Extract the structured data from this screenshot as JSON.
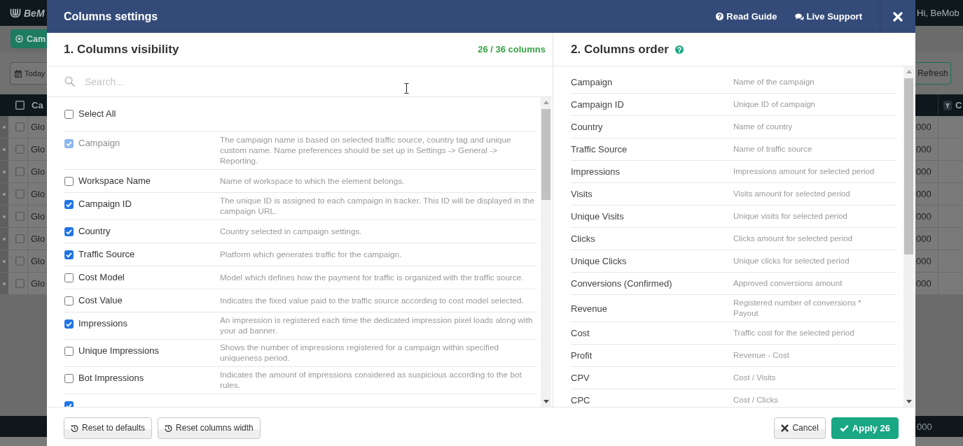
{
  "background": {
    "logo": "BeM",
    "greeting": "Hi, BeMob",
    "campaigns_button": "Cam",
    "date_button": "Today",
    "refresh_button": "Refresh",
    "table": {
      "header": {
        "checked": false,
        "column_1": "Ca",
        "column_2": "C"
      },
      "rows": [
        {
          "checked": false,
          "column_1": "Glo",
          "column_2": "000"
        },
        {
          "checked": false,
          "column_1": "Glo",
          "column_2": "000"
        },
        {
          "checked": false,
          "column_1": "Glo",
          "column_2": "000"
        },
        {
          "checked": false,
          "column_1": "Glo",
          "column_2": "000"
        },
        {
          "checked": false,
          "column_1": "Glo",
          "column_2": "000"
        },
        {
          "checked": false,
          "column_1": "Glo",
          "column_2": "000"
        },
        {
          "checked": false,
          "column_1": "Glo",
          "column_2": "000"
        },
        {
          "checked": false,
          "column_1": "Glo",
          "column_2": "000"
        }
      ],
      "totals": {
        "column_2": "000"
      }
    }
  },
  "dialog": {
    "title": "Columns settings",
    "header_links": [
      {
        "kind": "guide",
        "label": "Read Guide"
      },
      {
        "kind": "support",
        "label": "Live Support"
      }
    ],
    "visibility": {
      "title": "1. Columns visibility",
      "counter": "26 / 36 columns",
      "search": {
        "placeholder": "Search..."
      },
      "select_all": {
        "label": "Select All",
        "checked": false
      },
      "columns": [
        {
          "label": "Campaign",
          "description": "The campaign name is based on selected traffic source, country tag and unique custom name. Name preferences should be set up in Settings -> General -> Reporting.",
          "checked": true,
          "disabled": true
        },
        {
          "label": "Workspace Name",
          "description": "Name of workspace to which the element belongs.",
          "checked": false,
          "disabled": false
        },
        {
          "label": "Campaign ID",
          "description": "The unique ID is assigned to each campaign in tracker. This ID will be displayed in the campaign URL.",
          "checked": true,
          "disabled": false
        },
        {
          "label": "Country",
          "description": "Country selected in campaign settings.",
          "checked": true,
          "disabled": false
        },
        {
          "label": "Traffic Source",
          "description": "Platform which generates traffic for the campaign.",
          "checked": true,
          "disabled": false
        },
        {
          "label": "Cost Model",
          "description": "Model which defines how the payment for traffic is organized with the traffic source.",
          "checked": false,
          "disabled": false
        },
        {
          "label": "Cost Value",
          "description": "Indicates the fixed value paid to the traffic source according to cost model selected.",
          "checked": false,
          "disabled": false
        },
        {
          "label": "Impressions",
          "description": "An impression is registered each time the dedicated impression pixel loads along with your ad banner.",
          "checked": true,
          "disabled": false
        },
        {
          "label": "Unique Impressions",
          "description": "Shows the number of impressions registered for a campaign within specified uniqueness period.",
          "checked": false,
          "disabled": false
        },
        {
          "label": "Bot Impressions",
          "description": "Indicates the amount of impressions considered as suspicious according to the bot rules.",
          "checked": false,
          "disabled": false
        },
        {
          "checked": true,
          "disabled": false
        }
      ]
    },
    "order": {
      "title": "2. Columns order",
      "columns": [
        {
          "label": "Campaign",
          "description": "Name of the campaign"
        },
        {
          "label": "Campaign ID",
          "description": "Unique ID of campaign"
        },
        {
          "label": "Country",
          "description": "Name of country"
        },
        {
          "label": "Traffic Source",
          "description": "Name of traffic source"
        },
        {
          "label": "Impressions",
          "description": "Impressions amount for selected period"
        },
        {
          "label": "Visits",
          "description": "Visits amount for selected period"
        },
        {
          "label": "Unique Visits",
          "description": "Unique visits for selected period"
        },
        {
          "label": "Clicks",
          "description": "Clicks amount for selected period"
        },
        {
          "label": "Unique Clicks",
          "description": "Unique clicks for selected period"
        },
        {
          "label": "Conversions (Confirmed)",
          "description": "Approved conversions amount"
        },
        {
          "label": "Revenue",
          "description": "Registered number of conversions * Payout"
        },
        {
          "label": "Cost",
          "description": "Traffic cost for the selected period"
        },
        {
          "label": "Profit",
          "description": "Revenue - Cost"
        },
        {
          "label": "CPV",
          "description": "Cost / Visits"
        },
        {
          "label": "CPC",
          "description": "Cost / Clicks"
        }
      ]
    },
    "footer": {
      "left_buttons": [
        {
          "kind": "reset",
          "label": "Reset to defaults"
        },
        {
          "kind": "reset",
          "label": "Reset columns width"
        }
      ],
      "right_buttons": [
        {
          "kind": "cancel",
          "label": "Cancel"
        },
        {
          "kind": "apply",
          "label": "Apply 26"
        }
      ]
    }
  }
}
